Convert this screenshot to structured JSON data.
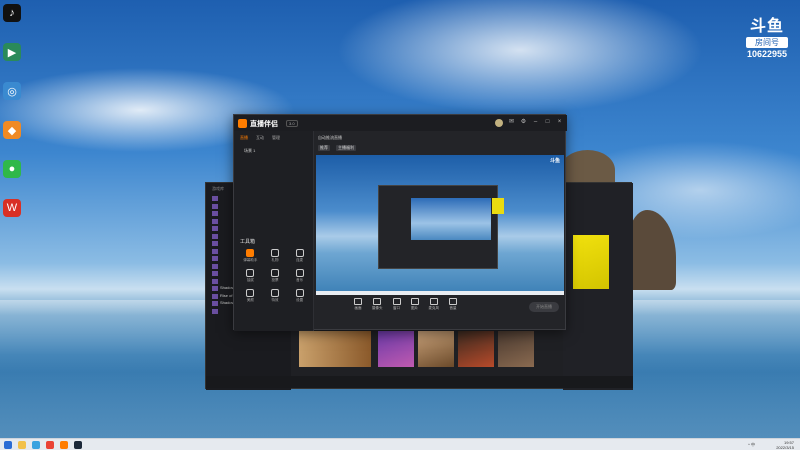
{
  "desktop": {
    "icons": [
      {
        "name": "tiktok-icon",
        "label": "",
        "color": "#111111",
        "glyph": "♪"
      },
      {
        "name": "app-icon-1",
        "label": "",
        "color": "#2a8a5a",
        "glyph": "▶"
      },
      {
        "name": "app-icon-2",
        "label": "",
        "color": "#3a8ad0",
        "glyph": "◎"
      },
      {
        "name": "app-icon-3",
        "label": "",
        "color": "#f08a24",
        "glyph": "◆"
      },
      {
        "name": "wechat-icon",
        "label": "",
        "color": "#2fb84a",
        "glyph": "●"
      },
      {
        "name": "wps-icon",
        "label": "",
        "color": "#d93025",
        "glyph": "W"
      }
    ]
  },
  "douyu_badge": {
    "logo": "斗鱼",
    "room_label": "房间号",
    "room_number": "10622955"
  },
  "main_window": {
    "title": "直播伴侣",
    "badge": "3.0",
    "tabs": [
      "直播",
      "互动",
      "管理"
    ],
    "scene_label": "场景 1",
    "stream_title": "自动推流直播",
    "tags": [
      "推荐",
      "主播福利"
    ],
    "tools_title": "工具箱",
    "tools": [
      {
        "label": "弹幕助手",
        "icon": "barrage-icon",
        "accent": true
      },
      {
        "label": "礼物",
        "icon": "gift-icon",
        "accent": false
      },
      {
        "label": "连麦",
        "icon": "connect-icon",
        "accent": false
      },
      {
        "label": "抽奖",
        "icon": "lottery-icon",
        "accent": false
      },
      {
        "label": "投票",
        "icon": "vote-icon",
        "accent": false
      },
      {
        "label": "音乐",
        "icon": "music-icon",
        "accent": false
      },
      {
        "label": "美颜",
        "icon": "beauty-icon",
        "accent": false
      },
      {
        "label": "特效",
        "icon": "effect-icon",
        "accent": false
      },
      {
        "label": "设置",
        "icon": "settings-icon",
        "accent": false
      }
    ],
    "bottom_tools": [
      {
        "label": "画面",
        "icon": "screen-icon"
      },
      {
        "label": "摄像头",
        "icon": "camera-icon"
      },
      {
        "label": "窗口",
        "icon": "window-icon"
      },
      {
        "label": "图片",
        "icon": "image-icon"
      },
      {
        "label": "麦克风",
        "icon": "mic-icon"
      },
      {
        "label": "音量",
        "icon": "volume-icon"
      }
    ],
    "start_live": "开始直播",
    "preview_logo": "斗鱼"
  },
  "back_window": {
    "sidebar_header": "游戏库",
    "sidebar_items": [
      "",
      "",
      "",
      "",
      "",
      "",
      "",
      "",
      "",
      "",
      "",
      "",
      "Shadow of the Tomb Raider",
      "Rise of the Tomb Raider",
      "Shadow of the Tomb Raider",
      ""
    ],
    "banner_text": "",
    "right_panel_title": "",
    "bottom_text": ""
  },
  "taskbar": {
    "time": "19:57",
    "date": "2022/3/15",
    "tray_text": "^ 中"
  },
  "colors": {
    "accent": "#ff7d00",
    "window_bg": "#232428",
    "taskbar_bg": "#e6eaef"
  }
}
